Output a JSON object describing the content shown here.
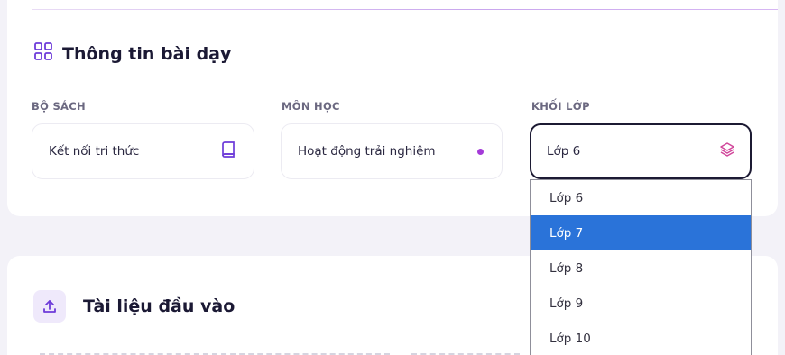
{
  "lesson_info": {
    "title": "Thông tin bài dạy",
    "book_set": {
      "label": "BỘ SÁCH",
      "value": "Kết nối tri thức"
    },
    "subject": {
      "label": "MÔN HỌC",
      "value": "Hoạt động trải nghiệm"
    },
    "grade": {
      "label": "KHỐI LỚP",
      "value": "Lớp 6",
      "options": [
        "Lớp 6",
        "Lớp 7",
        "Lớp 8",
        "Lớp 9",
        "Lớp 10"
      ],
      "highlighted": "Lớp 7"
    }
  },
  "input_docs": {
    "title": "Tài liệu đầu vào"
  },
  "colors": {
    "accent_purple": "#a43ad8",
    "highlight_blue": "#2a73d9",
    "text_dark": "#1b1934"
  }
}
